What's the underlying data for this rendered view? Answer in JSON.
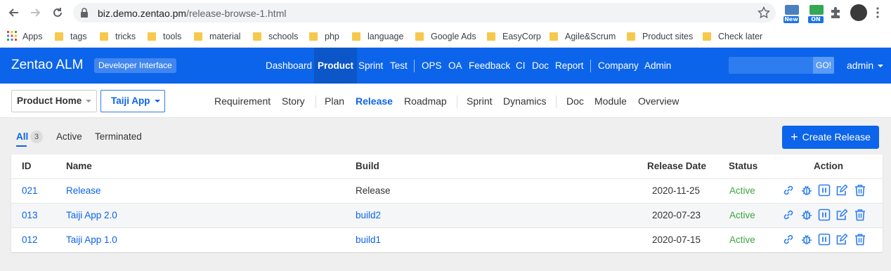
{
  "browser": {
    "url_host": "biz.demo.zentao.pm",
    "url_path": "/release-browse-1.html",
    "ext_new": "New",
    "ext_on": "ON",
    "bookmarks": [
      "Apps",
      "tags",
      "tricks",
      "tools",
      "material",
      "schools",
      "php",
      "language",
      "Google Ads",
      "EasyCorp",
      "Agile&Scrum",
      "Product sites",
      "Check later"
    ]
  },
  "header": {
    "logo": "Zentao ALM",
    "badge": "Developer Interface",
    "nav": [
      "Dashboard",
      "Product",
      "Sprint",
      "Test",
      "OPS",
      "OA",
      "Feedback",
      "CI",
      "Doc",
      "Report",
      "Company",
      "Admin"
    ],
    "active_nav": "Product",
    "go_label": "GO!",
    "user": "admin"
  },
  "subheader": {
    "home": "Product Home",
    "product": "Taiji App",
    "nav": [
      "Requirement",
      "Story",
      "Plan",
      "Release",
      "Roadmap",
      "Sprint",
      "Dynamics",
      "Doc",
      "Module",
      "Overview"
    ],
    "active": "Release"
  },
  "tabs": {
    "all": "All",
    "all_count": "3",
    "active": "Active",
    "terminated": "Terminated",
    "create_label": "Create Release"
  },
  "table": {
    "headers": [
      "ID",
      "Name",
      "Build",
      "Release Date",
      "Status",
      "Action"
    ],
    "rows": [
      {
        "id": "021",
        "name": "Release",
        "build": "Release",
        "build_is_link": false,
        "date": "2020-11-25",
        "status": "Active"
      },
      {
        "id": "013",
        "name": "Taiji App 2.0",
        "build": "build2",
        "build_is_link": true,
        "date": "2020-07-23",
        "status": "Active"
      },
      {
        "id": "012",
        "name": "Taiji App 1.0",
        "build": "build1",
        "build_is_link": true,
        "date": "2020-07-15",
        "status": "Active"
      }
    ],
    "action_icons": [
      "link-icon",
      "bug-icon",
      "pause-icon",
      "edit-icon",
      "delete-icon"
    ]
  },
  "colors": {
    "brand": "#0c64eb",
    "status_active": "#3fa63f"
  }
}
